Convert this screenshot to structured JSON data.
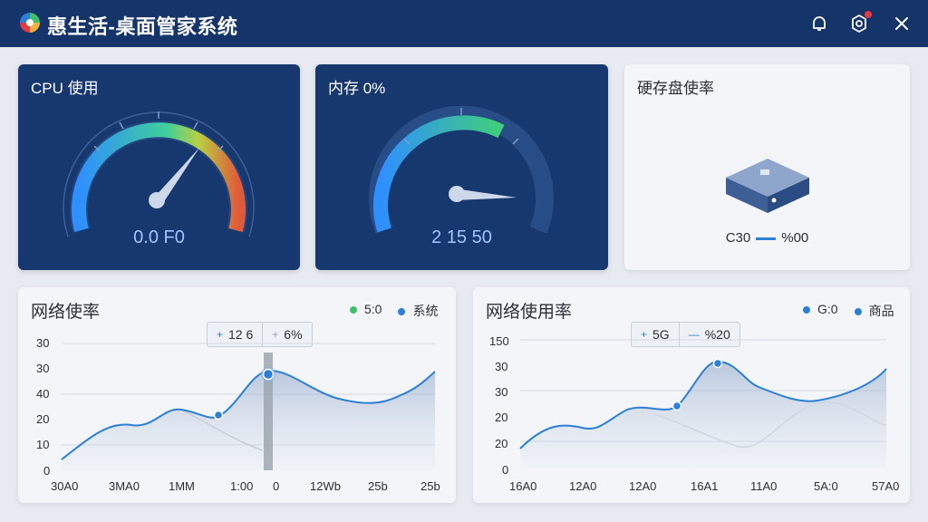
{
  "app": {
    "title": "惠生活-桌面管家系统"
  },
  "titlebar": {
    "bell_icon": "bell-icon",
    "settings_icon": "settings-icon",
    "close_icon": "close-icon"
  },
  "colors": {
    "titlebar": "#15346a",
    "card_dark": "#16386e",
    "accent": "#2c7fd6",
    "green": "#3fbf6a",
    "alert": "#e53945"
  },
  "cards": {
    "cpu": {
      "title": "CPU 使用",
      "value": "0.0 F0",
      "level": 0.72
    },
    "memory": {
      "title": "内存 0%",
      "value": "2 15 50",
      "level": 0.55
    },
    "disk": {
      "title": "硬存盘使率",
      "left": "C30",
      "right": "%00"
    }
  },
  "network_left": {
    "title": "网络使率",
    "legend": [
      {
        "label": "5:0",
        "color": "#3fbf6a"
      },
      {
        "label": "系统",
        "color": "#2c7fd6"
      }
    ],
    "tooltip": [
      "12 6",
      "6%"
    ],
    "y_ticks": [
      "30",
      "30",
      "40",
      "20",
      "10",
      "0"
    ],
    "x_ticks": [
      "30A0",
      "3MA0",
      "1MM",
      "1:00",
      "0",
      "12Wb",
      "25b",
      "25b"
    ]
  },
  "network_right": {
    "title": "网络使用率",
    "legend": [
      {
        "label": "G:0",
        "color": "#2c7fd6"
      },
      {
        "label": "商品",
        "color": "#2c7fd6"
      }
    ],
    "tooltip": [
      "5G",
      "%20"
    ],
    "y_ticks": [
      "150",
      "30",
      "30",
      "20",
      "20",
      "0"
    ],
    "x_ticks": [
      "16A0",
      "12A0",
      "12A0",
      "16A1",
      "11A0",
      "5A:0",
      "57A0"
    ]
  }
}
